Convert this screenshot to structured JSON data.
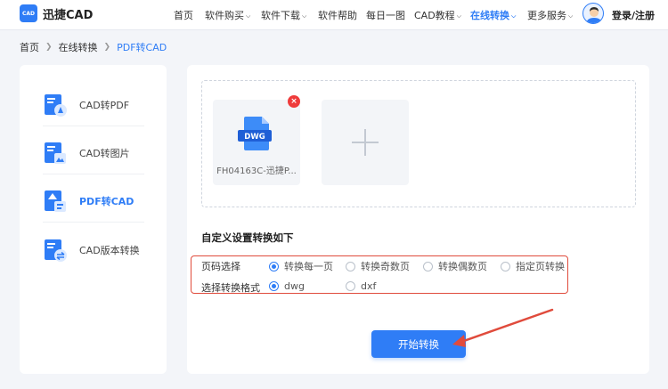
{
  "header": {
    "logo_badge": "CAD",
    "logo_text": "迅捷CAD",
    "nav": [
      {
        "label": "首页",
        "dropdown": false,
        "active": false
      },
      {
        "label": "软件购买",
        "dropdown": true,
        "active": false
      },
      {
        "label": "软件下载",
        "dropdown": true,
        "active": false
      },
      {
        "label": "软件帮助",
        "dropdown": false,
        "active": false
      },
      {
        "label": "每日一图",
        "dropdown": false,
        "active": false
      },
      {
        "label": "CAD教程",
        "dropdown": true,
        "active": false
      },
      {
        "label": "在线转换",
        "dropdown": true,
        "active": true
      },
      {
        "label": "更多服务",
        "dropdown": true,
        "active": false
      }
    ],
    "login_label": "登录/注册",
    "accent_color": "#2f7df6"
  },
  "breadcrumb": {
    "items": [
      "首页",
      "在线转换",
      "PDF转CAD"
    ]
  },
  "sidebar": {
    "items": [
      {
        "label": "CAD转PDF",
        "icon": "cad-to-pdf-icon",
        "active": false
      },
      {
        "label": "CAD转图片",
        "icon": "cad-to-image-icon",
        "active": false
      },
      {
        "label": "PDF转CAD",
        "icon": "pdf-to-cad-icon",
        "active": true
      },
      {
        "label": "CAD版本转换",
        "icon": "cad-version-icon",
        "active": false
      }
    ]
  },
  "upload": {
    "file_type_badge": "DWG",
    "file_name": "FH04163C-迅捷P..."
  },
  "settings": {
    "title": "自定义设置转换如下",
    "page_row": {
      "label": "页码选择",
      "options": [
        "转换每一页",
        "转换奇数页",
        "转换偶数页",
        "指定页转换"
      ],
      "selected": "转换每一页"
    },
    "format_row": {
      "label": "选择转换格式",
      "options": [
        "dwg",
        "dxf"
      ],
      "selected": "dwg"
    },
    "highlight_color": "#e04b3c"
  },
  "start_button_label": "开始转换"
}
